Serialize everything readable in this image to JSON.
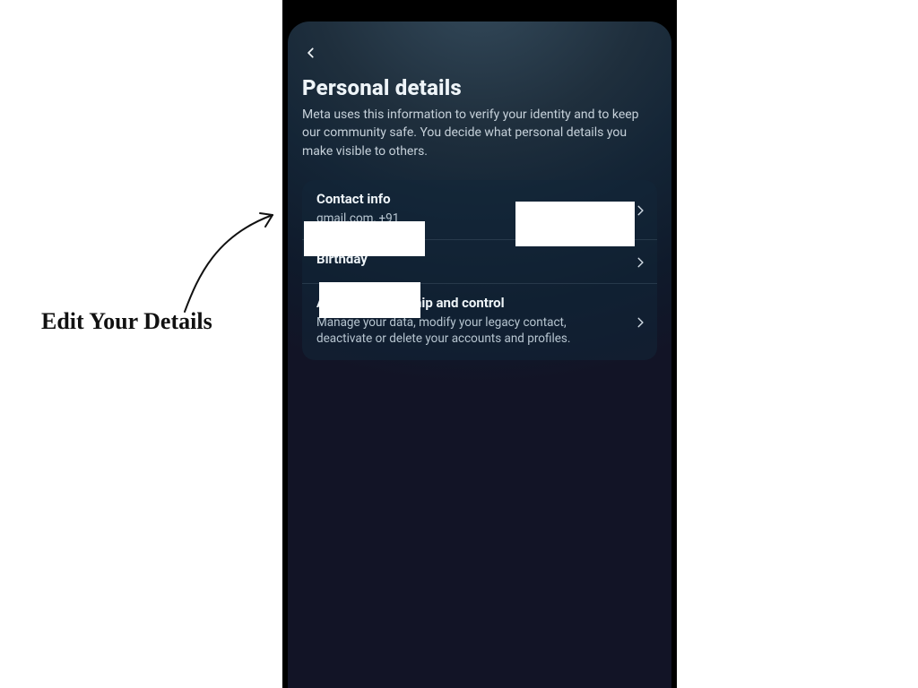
{
  "annotation": {
    "label": "Edit Your Details"
  },
  "header": {
    "title": "Personal details",
    "description": "Meta uses this information to verify your identity and to keep our community safe. You decide what personal details you make visible to others."
  },
  "rows": {
    "contact": {
      "title": "Contact info",
      "subtitle": "gmail.com, +91"
    },
    "birthday": {
      "title": "Birthday",
      "subtitle": ""
    },
    "ownership": {
      "title": "Account ownership and control",
      "subtitle": "Manage your data, modify your legacy contact, deactivate or delete your accounts and profiles."
    }
  }
}
